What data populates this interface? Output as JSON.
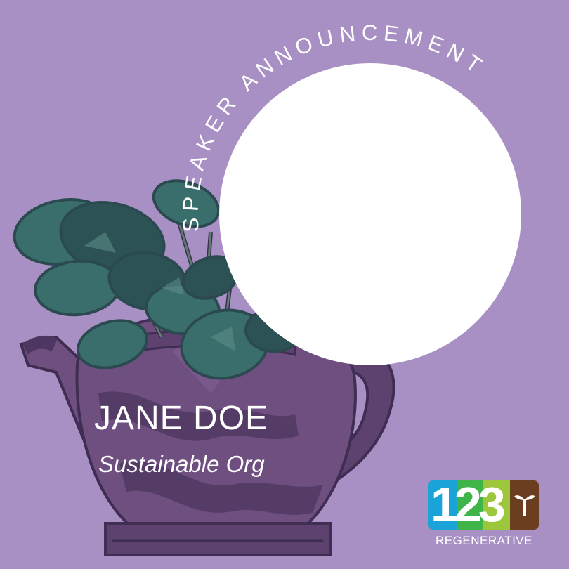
{
  "announcement": {
    "arc_text": "SPEAKER ANNOUNCEMENT"
  },
  "speaker": {
    "name": "JANE DOE",
    "organization": "Sustainable Org"
  },
  "logo": {
    "number": "123",
    "wordmark": "REGENERATIVE",
    "icon": "sprout-icon"
  },
  "illustration": {
    "icon": "teapot-plant-illustration"
  },
  "colors": {
    "background": "#a890c4",
    "teapot": "#6e4f80",
    "teapot_dark": "#4d3760",
    "leaves": "#3a6e6c",
    "leaves_dark": "#2d5256",
    "text": "#ffffff",
    "logo_blue": "#1aa3d6",
    "logo_green": "#3fb549",
    "logo_lime": "#9cc63b",
    "logo_brown": "#6b3e1f"
  }
}
